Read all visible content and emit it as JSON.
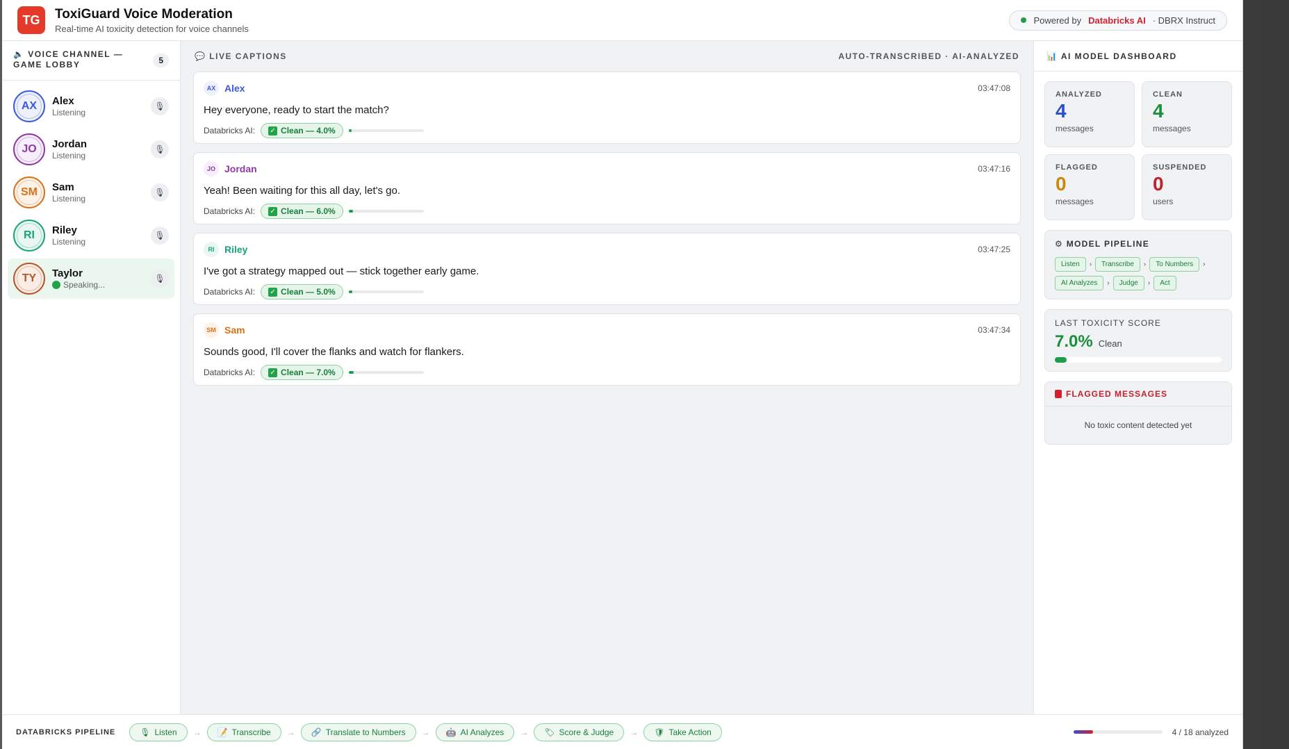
{
  "header": {
    "logo": "TG",
    "title": "ToxiGuard Voice Moderation",
    "subtitle": "Real-time AI toxicity detection for voice channels",
    "powered_prefix": "Powered by",
    "powered_brand": "Databricks AI",
    "powered_model": "· DBRX Instruct"
  },
  "channel": {
    "title": "🔈 VOICE CHANNEL — GAME LOBBY",
    "count": "5",
    "users": [
      {
        "initials": "AX",
        "name": "Alex",
        "status": "Listening",
        "color": "#3b5bdb",
        "bg": "#eef1fc",
        "active": false
      },
      {
        "initials": "JO",
        "name": "Jordan",
        "status": "Listening",
        "color": "#8e3aa3",
        "bg": "#f6eefa",
        "active": false
      },
      {
        "initials": "SM",
        "name": "Sam",
        "status": "Listening",
        "color": "#d9711a",
        "bg": "#fdf2e8",
        "active": false
      },
      {
        "initials": "RI",
        "name": "Riley",
        "status": "Listening",
        "color": "#1aa37a",
        "bg": "#e8f7f1",
        "active": false
      },
      {
        "initials": "TY",
        "name": "Taylor",
        "status": "Speaking...",
        "color": "#b5552d",
        "bg": "#fbece4",
        "active": true
      }
    ]
  },
  "captions": {
    "title": "💬 LIVE CAPTIONS",
    "right_label": "AUTO-TRANSCRIBED · AI-ANALYZED",
    "ai_label": "Databricks AI:",
    "items": [
      {
        "initials": "AX",
        "name": "Alex",
        "time": "03:47:08",
        "text": "Hey everyone, ready to start the match?",
        "verdict": "Clean — 4.0%",
        "score": 4.0,
        "color": "#3b5bdb",
        "bg": "#eef1fc"
      },
      {
        "initials": "JO",
        "name": "Jordan",
        "time": "03:47:16",
        "text": "Yeah! Been waiting for this all day, let's go.",
        "verdict": "Clean — 6.0%",
        "score": 6.0,
        "color": "#8e3aa3",
        "bg": "#f6eefa"
      },
      {
        "initials": "RI",
        "name": "Riley",
        "time": "03:47:25",
        "text": "I've got a strategy mapped out — stick together early game.",
        "verdict": "Clean — 5.0%",
        "score": 5.0,
        "color": "#1aa37a",
        "bg": "#e8f7f1"
      },
      {
        "initials": "SM",
        "name": "Sam",
        "time": "03:47:34",
        "text": "Sounds good, I'll cover the flanks and watch for flankers.",
        "verdict": "Clean — 7.0%",
        "score": 7.0,
        "color": "#d9711a",
        "bg": "#fdf2e8"
      }
    ]
  },
  "dashboard": {
    "title": "📊 AI MODEL DASHBOARD",
    "stats": [
      {
        "label": "ANALYZED",
        "value": "4",
        "unit": "messages",
        "color": "#2b50c9"
      },
      {
        "label": "CLEAN",
        "value": "4",
        "unit": "messages",
        "color": "#1a8f3c"
      },
      {
        "label": "FLAGGED",
        "value": "0",
        "unit": "messages",
        "color": "#c98a0c"
      },
      {
        "label": "SUSPENDED",
        "value": "0",
        "unit": "users",
        "color": "#c2202d"
      }
    ],
    "pipeline_title": "⚙ MODEL PIPELINE",
    "pipeline": [
      "Listen",
      "Transcribe",
      "To Numbers",
      "AI Analyzes",
      "Judge",
      "Act"
    ],
    "last_score_title": "LAST TOXICITY SCORE",
    "last_score": "7.0%",
    "last_score_value": 7.0,
    "last_score_label": "Clean",
    "flagged_title": "FLAGGED MESSAGES",
    "flagged_empty": "No toxic content detected yet"
  },
  "footer": {
    "label": "DATABRICKS PIPELINE",
    "steps": [
      {
        "icon": "🎙",
        "label": "Listen"
      },
      {
        "icon": "📝",
        "label": "Transcribe"
      },
      {
        "icon": "🔗",
        "label": "Translate to Numbers"
      },
      {
        "icon": "🤖",
        "label": "AI Analyzes"
      },
      {
        "icon": "🏷",
        "label": "Score & Judge"
      },
      {
        "icon": "🛡",
        "label": "Take Action"
      }
    ],
    "progress_text": "4 / 18 analyzed",
    "progress_fraction": 0.222
  }
}
